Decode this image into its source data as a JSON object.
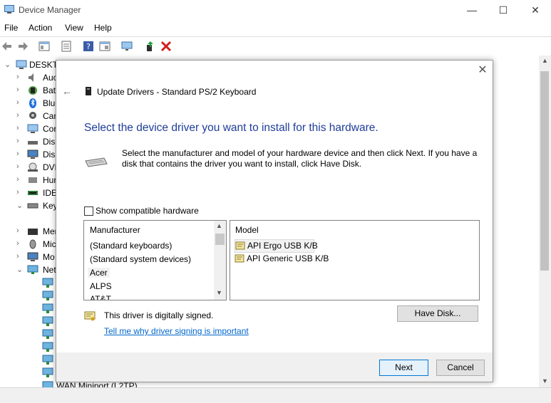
{
  "window": {
    "title": "Device Manager",
    "minimize": "—",
    "maximize": "☐",
    "close": "✕"
  },
  "menu": [
    "File",
    "Action",
    "View",
    "Help"
  ],
  "tree": {
    "root": "DESKTO",
    "items": [
      {
        "label": "Auc",
        "expander": "›",
        "icon": "speaker-icon"
      },
      {
        "label": "Batt",
        "expander": "›",
        "icon": "battery-icon"
      },
      {
        "label": "Blue",
        "expander": "›",
        "icon": "bluetooth-icon"
      },
      {
        "label": "Can",
        "expander": "›",
        "icon": "camera-icon"
      },
      {
        "label": "Cor",
        "expander": "›",
        "icon": "computer-icon"
      },
      {
        "label": "Disk",
        "expander": "›",
        "icon": "disk-drive-icon"
      },
      {
        "label": "Disp",
        "expander": "›",
        "icon": "display-adapter-icon"
      },
      {
        "label": "DVD",
        "expander": "›",
        "icon": "dvd-drive-icon"
      },
      {
        "label": "Hur",
        "expander": "›",
        "icon": "hid-icon"
      },
      {
        "label": "IDE",
        "expander": "›",
        "icon": "ide-controller-icon"
      },
      {
        "label": "Key",
        "expander": "⌄",
        "icon": "keyboard-icon"
      },
      {
        "label": "Mer",
        "expander": "›",
        "icon": "memory-icon"
      },
      {
        "label": "Mic",
        "expander": "›",
        "icon": "mouse-icon"
      },
      {
        "label": "Mo",
        "expander": "›",
        "icon": "monitor-icon"
      },
      {
        "label": "Net",
        "expander": "⌄",
        "icon": "network-adapter-icon"
      },
      {
        "label": "WAN Miniport (L2TP)",
        "expander": "",
        "icon": "network-adapter-icon"
      }
    ]
  },
  "dialog": {
    "title": "Update Drivers - Standard PS/2 Keyboard",
    "heading": "Select the device driver you want to install for this hardware.",
    "instructions": "Select the manufacturer and model of your hardware device and then click Next. If you have a disk that contains the driver you want to install, click Have Disk.",
    "compatible_label": "Show compatible hardware",
    "compatible_checked": false,
    "manufacturer_header": "Manufacturer",
    "manufacturers": [
      "(Standard keyboards)",
      "(Standard system devices)",
      "Acer",
      "ALPS",
      "AT&T"
    ],
    "selected_manufacturer": "Acer",
    "model_header": "Model",
    "models": [
      "API Ergo USB K/B",
      "API Generic USB K/B"
    ],
    "selected_model": "API Ergo USB K/B",
    "signed_text": "This driver is digitally signed.",
    "signing_link": "Tell me why driver signing is important",
    "have_disk": "Have Disk...",
    "next": "Next",
    "cancel": "Cancel",
    "close": "✕",
    "back": "←"
  },
  "colors": {
    "heading": "#1f3d99",
    "link": "#0066cc",
    "primary_border": "#0078d7"
  }
}
